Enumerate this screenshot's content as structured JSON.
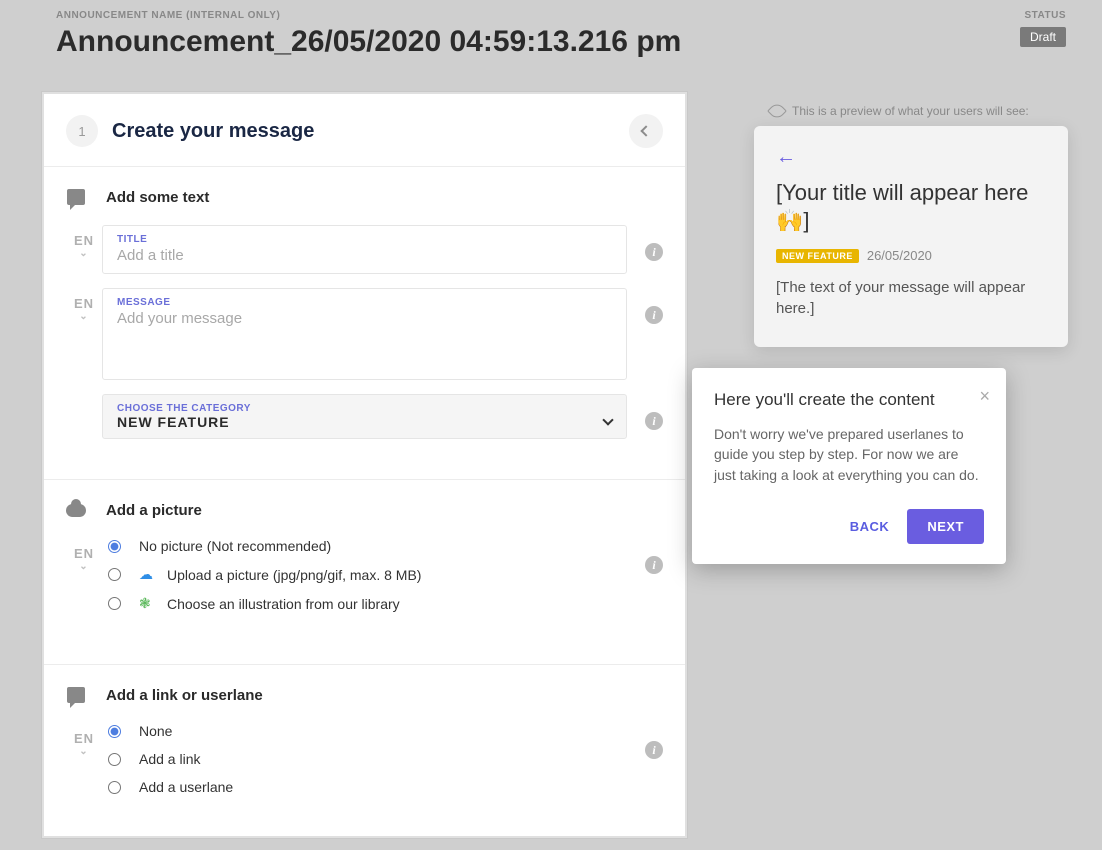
{
  "header": {
    "name_label": "ANNOUNCEMENT NAME (INTERNAL ONLY)",
    "title": "Announcement_26/05/2020 04:59:13.216 pm",
    "status_label": "STATUS",
    "status_value": "Draft"
  },
  "step": {
    "number": "1",
    "title": "Create your message"
  },
  "text_section": {
    "heading": "Add some text",
    "lang": "EN",
    "title_field": {
      "label": "TITLE",
      "placeholder": "Add a title"
    },
    "message_field": {
      "label": "MESSAGE",
      "placeholder": "Add your message"
    },
    "category_field": {
      "label": "CHOOSE THE CATEGORY",
      "value": "NEW FEATURE"
    }
  },
  "picture_section": {
    "heading": "Add a picture",
    "lang": "EN",
    "options": {
      "none": "No picture (Not recommended)",
      "upload": "Upload a picture (jpg/png/gif, max. 8 MB)",
      "library": "Choose an illustration from our library"
    }
  },
  "link_section": {
    "heading": "Add a link or userlane",
    "lang": "EN",
    "options": {
      "none": "None",
      "link": "Add a link",
      "userlane": "Add a userlane"
    }
  },
  "preview": {
    "caption": "This is a preview of what your users will see:",
    "title": "[Your title will appear here 🙌]",
    "badge": "NEW FEATURE",
    "date": "26/05/2020",
    "body": "[The text of your message will appear here.]"
  },
  "tour": {
    "title": "Here you'll create the content",
    "body": "Don't worry we've prepared userlanes to guide you step by step. For now we are just taking a look at everything you can do.",
    "back": "BACK",
    "next": "NEXT"
  }
}
